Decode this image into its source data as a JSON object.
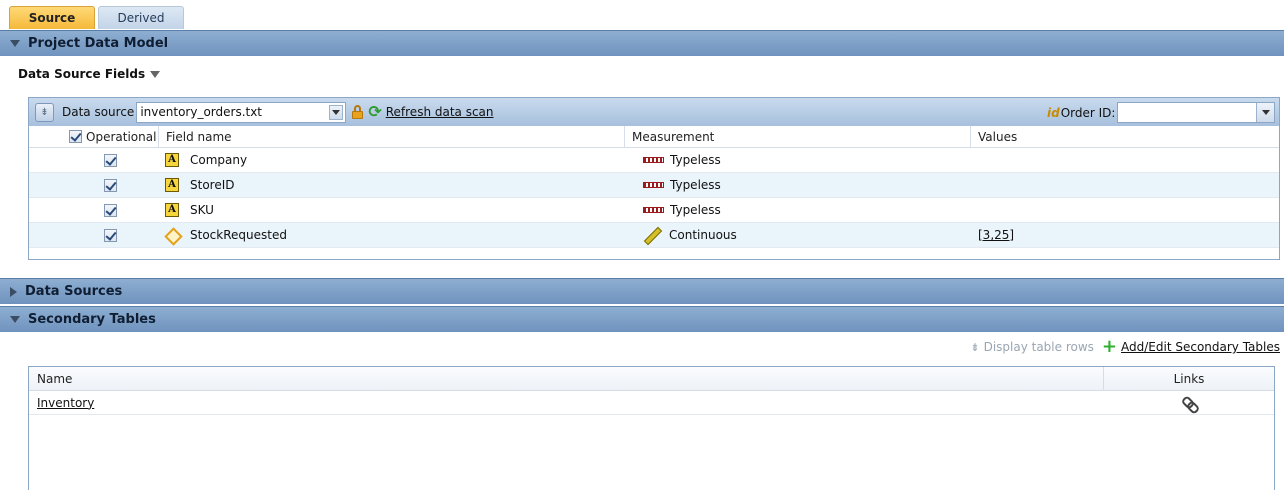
{
  "tabs": [
    {
      "label": "Source",
      "active": true
    },
    {
      "label": "Derived",
      "active": false
    }
  ],
  "sections": {
    "project_data_model": "Project Data Model",
    "data_sources": "Data Sources",
    "secondary_tables": "Secondary Tables"
  },
  "data_source_fields": {
    "heading": "Data Source Fields",
    "toolbar": {
      "data_source_label": "Data source",
      "data_source_value": "inventory_orders.txt",
      "refresh_label": "Refresh data scan",
      "id_icon_text": "id",
      "order_id_label": "Order ID:",
      "order_id_value": ""
    },
    "columns": {
      "operational": "Operational",
      "field_name": "Field name",
      "measurement": "Measurement",
      "values": "Values"
    },
    "rows": [
      {
        "operational": true,
        "type_icon": "string-type-icon",
        "name": "Company",
        "measurement": "Typeless",
        "measurement_icon": "typeless-icon",
        "values": ""
      },
      {
        "operational": true,
        "type_icon": "string-type-icon",
        "name": "StoreID",
        "measurement": "Typeless",
        "measurement_icon": "typeless-icon",
        "values": ""
      },
      {
        "operational": true,
        "type_icon": "string-type-icon",
        "name": "SKU",
        "measurement": "Typeless",
        "measurement_icon": "typeless-icon",
        "values": ""
      },
      {
        "operational": true,
        "type_icon": "continuous-type-icon",
        "name": "StockRequested",
        "measurement": "Continuous",
        "measurement_icon": "ruler-icon",
        "values": "[3,25]"
      }
    ]
  },
  "secondary_tables": {
    "display_rows_label": "Display table rows",
    "add_edit_label": "Add/Edit Secondary Tables",
    "columns": {
      "name": "Name",
      "links": "Links"
    },
    "rows": [
      {
        "name": "Inventory",
        "links_icon": "chain-link-icon"
      }
    ]
  },
  "colors": {
    "section_header": "#7f9fc8",
    "active_tab": "#f5b93a",
    "alt_row": "#e9f4fb"
  }
}
